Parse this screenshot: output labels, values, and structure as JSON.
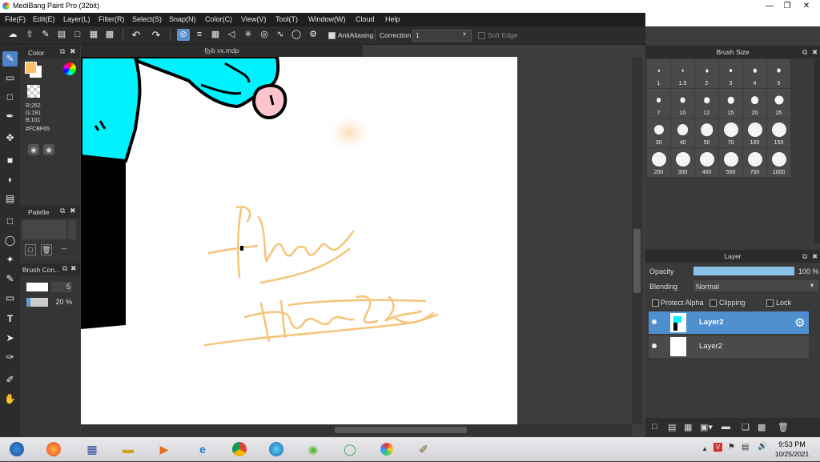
{
  "window": {
    "title": "MediBang Paint Pro (32bit)",
    "controls": [
      "minimize",
      "maximize",
      "close"
    ]
  },
  "menu": [
    "File(F)",
    "Edit(E)",
    "Layer(L)",
    "Filter(R)",
    "Select(S)",
    "Snap(N)",
    "Color(C)",
    "View(V)",
    "Tool(T)",
    "Window(W)",
    "Cloud",
    "Help"
  ],
  "toolbar": {
    "antialiasing_label": "AntiAliasing",
    "correction_label": "Correction",
    "correction_value": "1",
    "soft_edge_label": "Soft Edge"
  },
  "color_panel": {
    "title": "Color",
    "r": "R:252",
    "g": "G:191",
    "b": "B:101",
    "hex": "#FCBF65",
    "primary": "#FCBF65",
    "secondary": "#FFFFFF"
  },
  "palette_panel": {
    "title": "Palette",
    "dash": "---"
  },
  "brush_control": {
    "title": "Brush Con...",
    "size": "5",
    "opacity": "20 %",
    "opacity_fraction": 0.2
  },
  "document": {
    "tab": "fjyb vx.mdp"
  },
  "brush_size": {
    "title": "Brush Size",
    "sizes": [
      "1",
      "1.5",
      "2",
      "3",
      "4",
      "5",
      "7",
      "10",
      "12",
      "15",
      "20",
      "25",
      "30",
      "40",
      "50",
      "70",
      "100",
      "150",
      "200",
      "300",
      "400",
      "500",
      "700",
      "1000"
    ]
  },
  "layer_panel": {
    "title": "Layer",
    "opacity_label": "Opacity",
    "opacity_value": "100 %",
    "opacity_fraction": 1.0,
    "blending_label": "Blending",
    "blending_value": "Normal",
    "protect_alpha_label": "Protect Alpha",
    "clipping_label": "Clipping",
    "lock_label": "Lock",
    "layers": [
      {
        "name": "Layer2",
        "selected": true
      },
      {
        "name": "Layer2",
        "selected": false
      }
    ]
  },
  "taskbar": {
    "time": "9:53 PM",
    "date": "10/25/2021"
  },
  "icons": [
    "pen-icon",
    "eraser-icon",
    "rectangle-icon",
    "fill-icon",
    "text-icon",
    "hand-icon",
    "undo-icon",
    "redo-icon",
    "gear-icon"
  ]
}
